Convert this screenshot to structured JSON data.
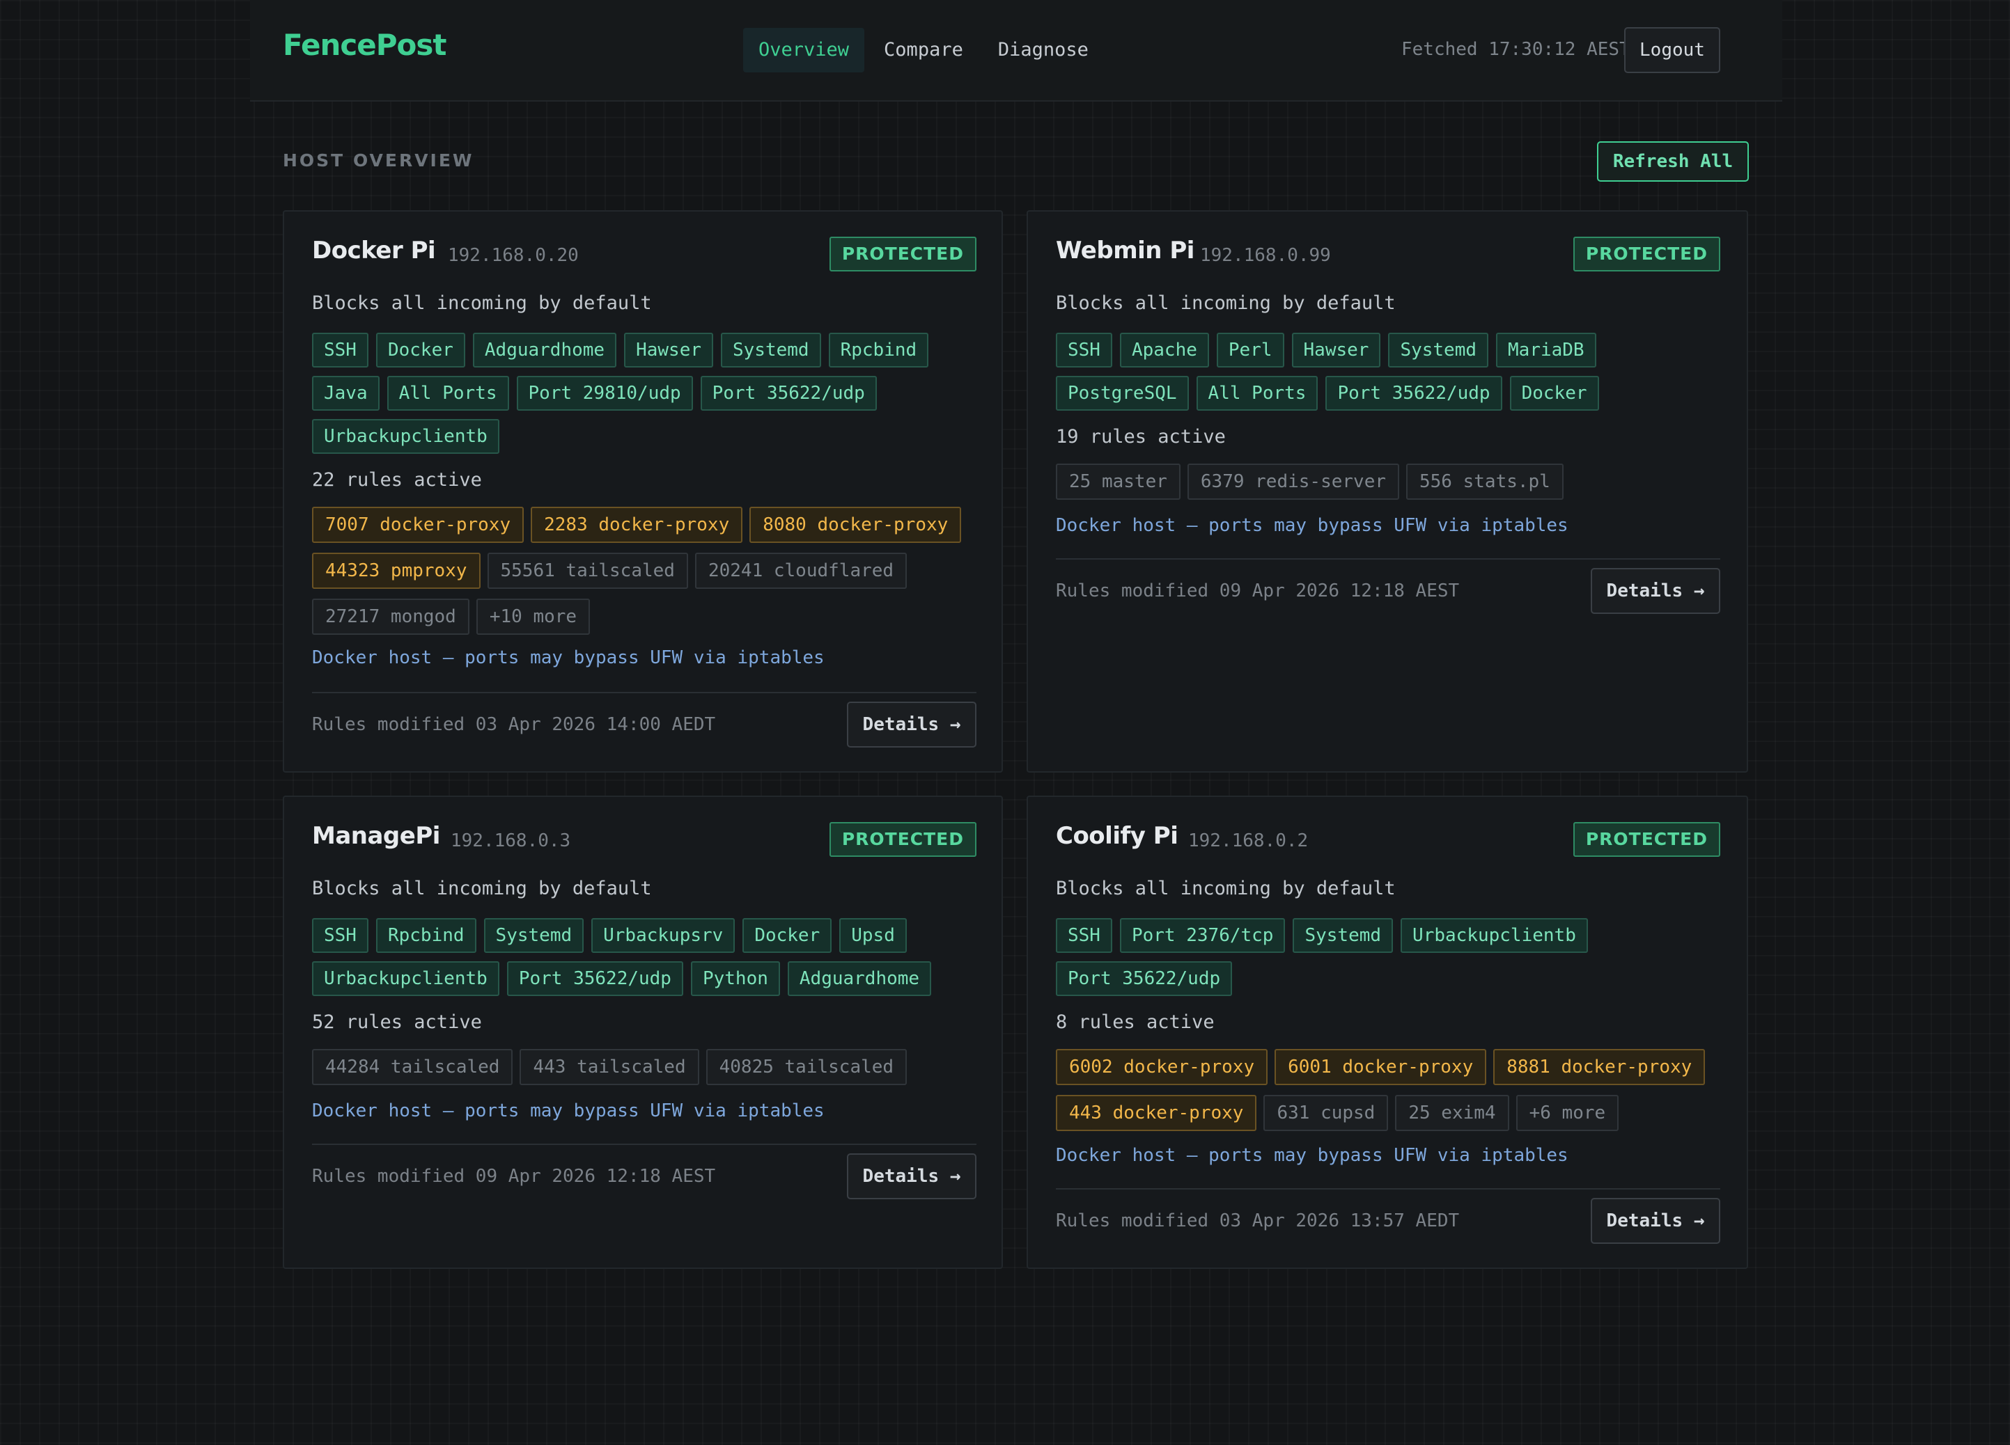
{
  "header": {
    "logo": "FencePost",
    "nav": [
      {
        "label": "Overview",
        "active": true
      },
      {
        "label": "Compare",
        "active": false
      },
      {
        "label": "Diagnose",
        "active": false
      }
    ],
    "fetched": "Fetched 17:30:12 AEST",
    "logout_label": "Logout"
  },
  "section": {
    "title": "HOST OVERVIEW",
    "refresh_label": "Refresh All"
  },
  "colors": {
    "accent": "#3fcf92",
    "warn": "#f2b74a",
    "link": "#7ea7dc"
  },
  "hosts": [
    {
      "name": "Docker Pi",
      "ip": "192.168.0.20",
      "status": "PROTECTED",
      "default_policy": "Blocks all incoming by default",
      "services": [
        "SSH",
        "Docker",
        "Adguardhome",
        "Hawser",
        "Systemd",
        "Rpcbind",
        "Java",
        "All Ports",
        "Port 29810/udp",
        "Port 35622/udp",
        "Urbackupclientb"
      ],
      "rules_active": "22 rules active",
      "ports": [
        {
          "label": "7007 docker-proxy",
          "kind": "warn"
        },
        {
          "label": "2283 docker-proxy",
          "kind": "warn"
        },
        {
          "label": "8080 docker-proxy",
          "kind": "warn"
        },
        {
          "label": "44323 pmproxy",
          "kind": "warn"
        },
        {
          "label": "55561 tailscaled",
          "kind": "plain"
        },
        {
          "label": "20241 cloudflared",
          "kind": "plain"
        },
        {
          "label": "27217 mongod",
          "kind": "plain"
        },
        {
          "label": "+10 more",
          "kind": "more"
        }
      ],
      "docker_warning": "Docker host — ports may bypass UFW via iptables",
      "modified": "Rules modified 03 Apr 2026 14:00 AEDT",
      "details_label": "Details →"
    },
    {
      "name": "Webmin Pi",
      "ip": "192.168.0.99",
      "status": "PROTECTED",
      "default_policy": "Blocks all incoming by default",
      "services": [
        "SSH",
        "Apache",
        "Perl",
        "Hawser",
        "Systemd",
        "MariaDB",
        "PostgreSQL",
        "All Ports",
        "Port 35622/udp",
        "Docker"
      ],
      "rules_active": "19 rules active",
      "ports": [
        {
          "label": "25 master",
          "kind": "plain"
        },
        {
          "label": "6379 redis-server",
          "kind": "plain"
        },
        {
          "label": "556 stats.pl",
          "kind": "plain"
        }
      ],
      "docker_warning": "Docker host — ports may bypass UFW via iptables",
      "modified": "Rules modified 09 Apr 2026 12:18 AEST",
      "details_label": "Details →"
    },
    {
      "name": "ManagePi",
      "ip": "192.168.0.3",
      "status": "PROTECTED",
      "default_policy": "Blocks all incoming by default",
      "services": [
        "SSH",
        "Rpcbind",
        "Systemd",
        "Urbackupsrv",
        "Docker",
        "Upsd",
        "Urbackupclientb",
        "Port 35622/udp",
        "Python",
        "Adguardhome"
      ],
      "rules_active": "52 rules active",
      "ports": [
        {
          "label": "44284 tailscaled",
          "kind": "plain"
        },
        {
          "label": "443 tailscaled",
          "kind": "plain"
        },
        {
          "label": "40825 tailscaled",
          "kind": "plain"
        }
      ],
      "docker_warning": "Docker host — ports may bypass UFW via iptables",
      "modified": "Rules modified 09 Apr 2026 12:18 AEST",
      "details_label": "Details →"
    },
    {
      "name": "Coolify Pi",
      "ip": "192.168.0.2",
      "status": "PROTECTED",
      "default_policy": "Blocks all incoming by default",
      "services": [
        "SSH",
        "Port 2376/tcp",
        "Systemd",
        "Urbackupclientb",
        "Port 35622/udp"
      ],
      "rules_active": "8 rules active",
      "ports": [
        {
          "label": "6002 docker-proxy",
          "kind": "warn"
        },
        {
          "label": "6001 docker-proxy",
          "kind": "warn"
        },
        {
          "label": "8881 docker-proxy",
          "kind": "warn"
        },
        {
          "label": "443 docker-proxy",
          "kind": "warn"
        },
        {
          "label": "631 cupsd",
          "kind": "plain"
        },
        {
          "label": "25 exim4",
          "kind": "plain"
        },
        {
          "label": "+6 more",
          "kind": "more"
        }
      ],
      "docker_warning": "Docker host — ports may bypass UFW via iptables",
      "modified": "Rules modified 03 Apr 2026 13:57 AEDT",
      "details_label": "Details →"
    }
  ]
}
